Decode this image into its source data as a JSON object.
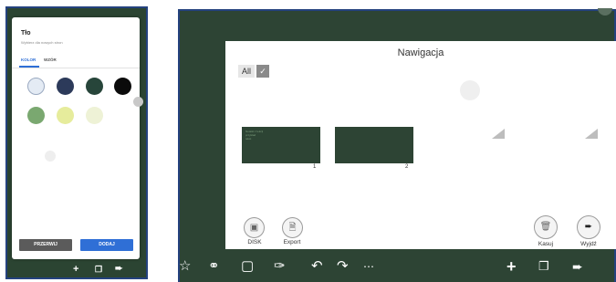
{
  "left_screen": {
    "dialog": {
      "title": "Tło",
      "subtitle": "Wybierz dla nowych stron",
      "tabs": [
        {
          "label": "KOLOR",
          "active": true
        },
        {
          "label": "WZÓR",
          "active": false
        }
      ],
      "swatches": [
        {
          "name": "light-blue",
          "color": "#e4ebf4",
          "selected": true
        },
        {
          "name": "navy",
          "color": "#2c3a5a",
          "selected": false
        },
        {
          "name": "dark-green",
          "color": "#27453a",
          "selected": false
        },
        {
          "name": "black",
          "color": "#0b0b0b",
          "selected": false
        },
        {
          "name": "green",
          "color": "#7aa870",
          "selected": false
        },
        {
          "name": "yellow",
          "color": "#e6ec9c",
          "selected": false
        },
        {
          "name": "pale-yellow",
          "color": "#eef2d6",
          "selected": false
        }
      ],
      "cancel_label": "PRZERWIJ",
      "add_label": "DODAJ"
    },
    "toolbar_icons": [
      "plus-icon",
      "pages-icon",
      "exit-icon"
    ]
  },
  "right_screen": {
    "nav_title": "Nawigacja",
    "all_label": "All",
    "pages": [
      {
        "number": "1",
        "thumb_text": [
          "Notatki z lekcji",
          "przykład",
          "tekst"
        ]
      },
      {
        "number": "2",
        "thumb_text": []
      }
    ],
    "disk_label": "DISK",
    "export_label": "Export",
    "delete_label": "Kasuj",
    "exit_label": "Wyjdź",
    "toolbar_left": [
      "star-icon",
      "lasso-icon",
      "eraser-icon",
      "brush-icon",
      "undo-icon",
      "redo-icon",
      "more-icon"
    ],
    "toolbar_right": [
      "plus-icon",
      "pages-icon",
      "exit-icon"
    ]
  },
  "colors": {
    "board": "#2d4434",
    "frame_border": "#24427e",
    "accent_blue": "#2f6fd6",
    "cancel_button": "#5b5b5b"
  }
}
